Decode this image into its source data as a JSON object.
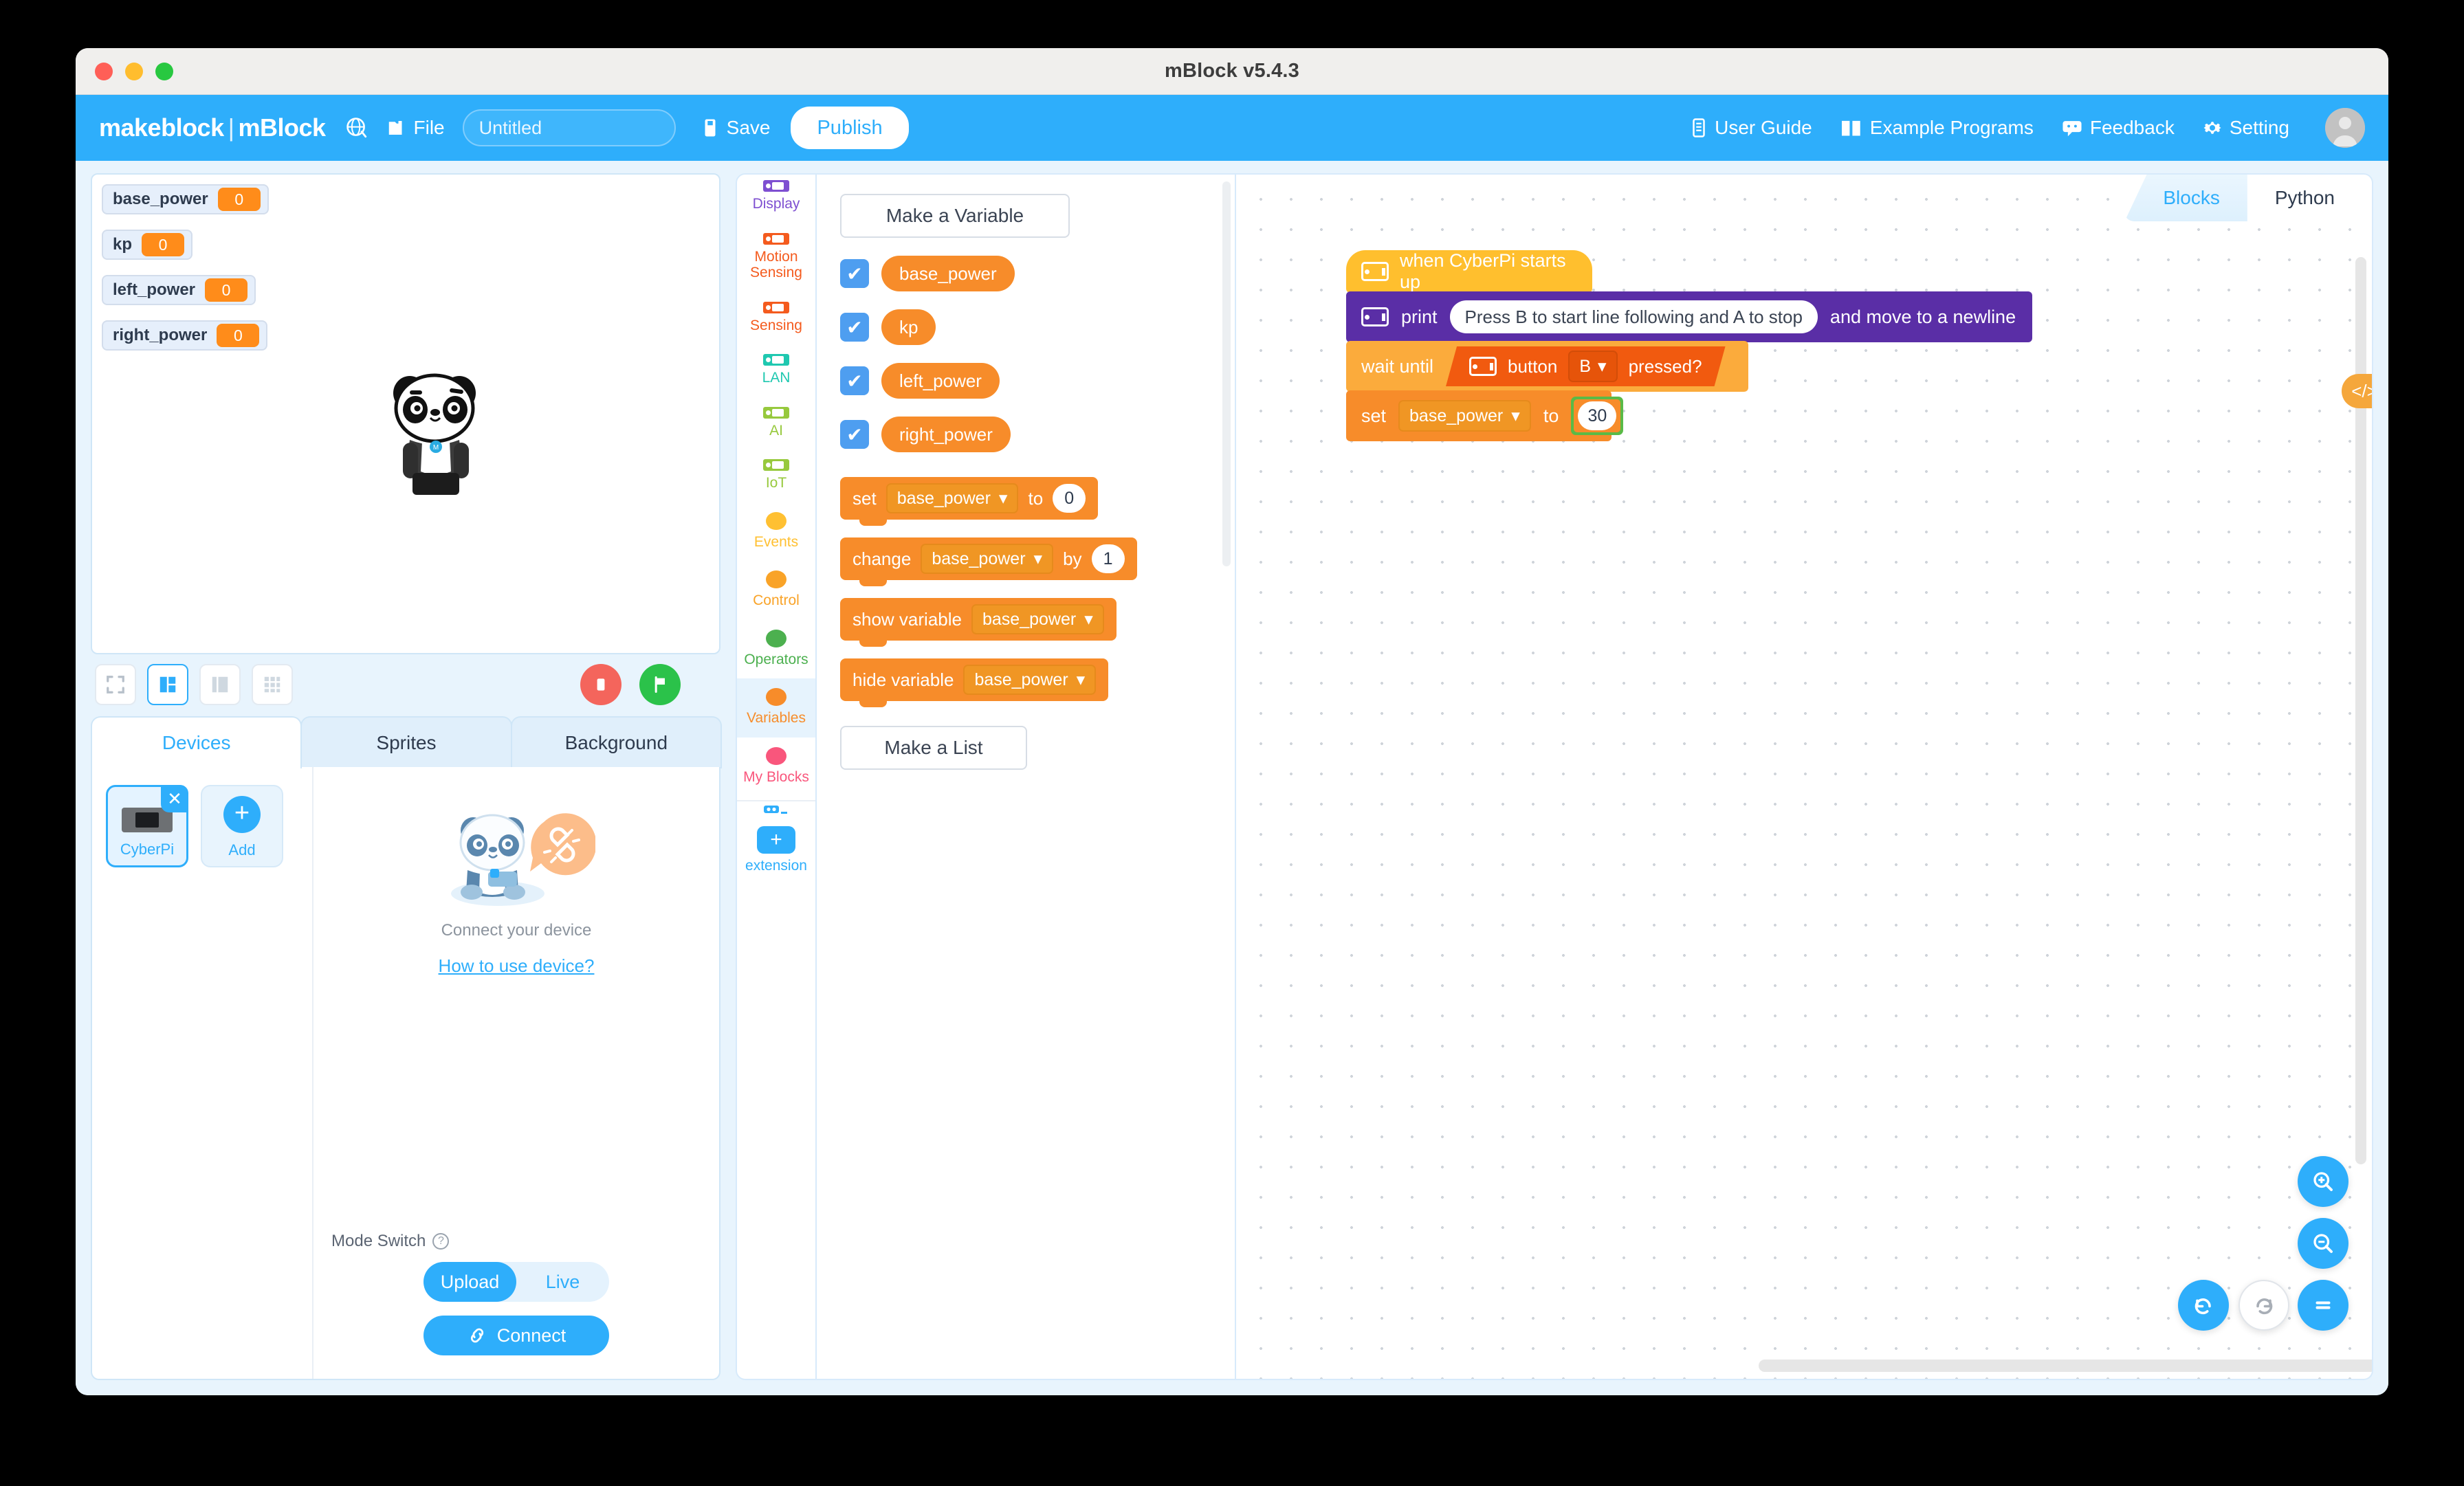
{
  "window": {
    "title": "mBlock v5.4.3"
  },
  "header": {
    "brand_left": "makeblock",
    "brand_sep": "|",
    "brand_right": "mBlock",
    "globe_icon": "globe-icon",
    "file_icon": "folder-icon",
    "file_label": "File",
    "project_name": "Untitled",
    "project_placeholder": "Untitled",
    "save_icon": "save-icon",
    "save_label": "Save",
    "publish_label": "Publish",
    "right_items": [
      {
        "icon": "book-icon",
        "label": "User Guide"
      },
      {
        "icon": "open-book-icon",
        "label": "Example Programs"
      },
      {
        "icon": "chat-icon",
        "label": "Feedback"
      },
      {
        "icon": "gear-icon",
        "label": "Setting"
      }
    ],
    "avatar_icon": "avatar-icon"
  },
  "stage": {
    "watchers": [
      {
        "name": "base_power",
        "value": "0"
      },
      {
        "name": "kp",
        "value": "0"
      },
      {
        "name": "left_power",
        "value": "0"
      },
      {
        "name": "right_power",
        "value": "0"
      }
    ],
    "sprite": "panda-sprite",
    "controls": {
      "fullscreen_icon": "fullscreen-icon",
      "layout_small_icon": "layout-small-icon",
      "layout_large_icon": "layout-large-icon",
      "layout_grid_icon": "layout-grid-icon",
      "stop_icon": "stop-icon",
      "start_icon": "green-flag-icon"
    }
  },
  "panel": {
    "tabs": [
      {
        "label": "Devices",
        "active": true
      },
      {
        "label": "Sprites",
        "active": false
      },
      {
        "label": "Background",
        "active": false
      }
    ],
    "device": {
      "name": "CyberPi",
      "close_icon": "close-icon",
      "thumb_icon": "cyberpi-thumb-icon"
    },
    "add": {
      "label": "Add",
      "icon": "plus-icon"
    },
    "connect_illustration": "panda-disconnected-illustration",
    "connect_text": "Connect your device",
    "how_to_link": "How to use device?",
    "mode_switch_label": "Mode Switch",
    "mode_help_icon": "question-icon",
    "mode_upload": "Upload",
    "mode_live": "Live",
    "connect_icon": "link-icon",
    "connect_button": "Connect"
  },
  "categories": [
    {
      "label": "Display",
      "color": "#7e4fd1",
      "shape": "block"
    },
    {
      "label": "Motion Sensing",
      "color": "#f45b1e",
      "shape": "block"
    },
    {
      "label": "Sensing",
      "color": "#f45b1e",
      "shape": "block"
    },
    {
      "label": "LAN",
      "color": "#1fc8b0",
      "shape": "block"
    },
    {
      "label": "AI",
      "color": "#97c93d",
      "shape": "block"
    },
    {
      "label": "IoT",
      "color": "#97c93d",
      "shape": "block"
    },
    {
      "label": "Events",
      "color": "#ffc032",
      "shape": "circle"
    },
    {
      "label": "Control",
      "color": "#f9a328",
      "shape": "circle"
    },
    {
      "label": "Operators",
      "color": "#4cb04f",
      "shape": "circle"
    },
    {
      "label": "Variables",
      "color": "#f78c2a",
      "shape": "circle",
      "active": true
    },
    {
      "label": "My Blocks",
      "color": "#f9567c",
      "shape": "circle"
    }
  ],
  "extension": {
    "label": "extension",
    "icon": "plus-icon",
    "header_icon": "extension-icon"
  },
  "palette": {
    "make_variable": "Make a Variable",
    "make_list": "Make a List",
    "variables": [
      {
        "name": "base_power",
        "checked": true
      },
      {
        "name": "kp",
        "checked": true
      },
      {
        "name": "left_power",
        "checked": true
      },
      {
        "name": "right_power",
        "checked": true
      }
    ],
    "blocks": {
      "set_label": "set",
      "set_var": "base_power",
      "set_to": "to",
      "set_value": "0",
      "change_label": "change",
      "change_var": "base_power",
      "change_by": "by",
      "change_value": "1",
      "show_label": "show variable",
      "show_var": "base_power",
      "hide_label": "hide variable",
      "hide_var": "base_power",
      "dropdown_icon": "chevron-down-icon"
    }
  },
  "code_area": {
    "tabs": [
      {
        "label": "Blocks",
        "active": true
      },
      {
        "label": "Python",
        "active": false
      }
    ],
    "code_toggle_icon": "code-icon",
    "code_toggle_label": "</>",
    "script": {
      "hat": {
        "icon": "cyberpi-chip-icon",
        "label": "when CyberPi starts up"
      },
      "print": {
        "icon": "cyberpi-chip-icon",
        "label": "print",
        "value": "Press B to start line following and A to stop",
        "suffix": "and move to a newline"
      },
      "wait_until": {
        "label": "wait until",
        "icon": "cyberpi-chip-icon",
        "button_label": "button",
        "button_value": "B",
        "pressed_label": "pressed?"
      },
      "set": {
        "label": "set",
        "variable": "base_power",
        "to": "to",
        "value": "30",
        "highlight_color": "#5aba47"
      }
    },
    "fabs": [
      {
        "name": "zoom-in-button",
        "icon": "zoom-in-icon"
      },
      {
        "name": "zoom-out-button",
        "icon": "zoom-out-icon"
      },
      {
        "name": "zoom-reset-button",
        "icon": "equals-icon"
      },
      {
        "name": "undo-button",
        "icon": "undo-icon"
      },
      {
        "name": "redo-button",
        "icon": "redo-icon"
      }
    ]
  },
  "colors": {
    "accent": "#2eaefb",
    "variables": "#f78c2a",
    "events": "#ffbf2e",
    "display": "#5a2ea6",
    "sensing": "#f15a0f",
    "control": "#fbab3c",
    "highlight": "#5aba47"
  }
}
